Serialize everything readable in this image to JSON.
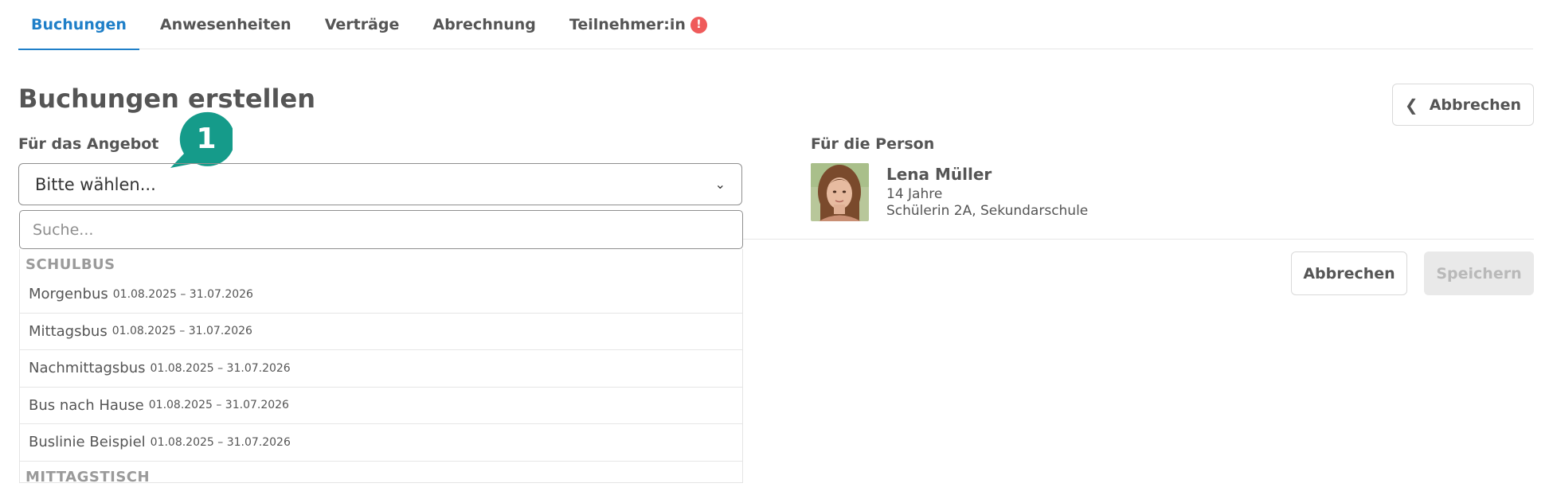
{
  "tabs": [
    {
      "label": "Buchungen",
      "active": true
    },
    {
      "label": "Anwesenheiten"
    },
    {
      "label": "Verträge"
    },
    {
      "label": "Abrechnung"
    },
    {
      "label": "Teilnehmer:in",
      "alert": "!"
    }
  ],
  "page": {
    "title": "Buchungen erstellen"
  },
  "header_actions": {
    "cancel_label": "Abbrechen",
    "back_icon": "chevron-left-icon"
  },
  "offer": {
    "label": "Für das Angebot",
    "select_value": "Bitte wählen...",
    "search_placeholder": "Suche...",
    "step_badge": "1",
    "groups": [
      {
        "name": "SCHULBUS",
        "options": [
          {
            "name": "Morgenbus",
            "dates": "01.08.2025 – 31.07.2026"
          },
          {
            "name": "Mittagsbus",
            "dates": "01.08.2025 – 31.07.2026"
          },
          {
            "name": "Nachmittagsbus",
            "dates": "01.08.2025 – 31.07.2026"
          },
          {
            "name": "Bus nach Hause",
            "dates": "01.08.2025 – 31.07.2026"
          },
          {
            "name": "Buslinie Beispiel",
            "dates": "01.08.2025 – 31.07.2026"
          }
        ]
      },
      {
        "name": "MITTAGSTISCH",
        "options": []
      }
    ]
  },
  "person": {
    "label": "Für die Person",
    "name": "Lena Müller",
    "age": "14 Jahre",
    "school": "Schülerin 2A, Sekundarschule"
  },
  "footer_actions": {
    "cancel_label": "Abbrechen",
    "save_label": "Speichern",
    "save_disabled": true
  },
  "colors": {
    "accent": "#1f7fc8",
    "badge": "#159b8a",
    "alert": "#ef5b5b"
  }
}
